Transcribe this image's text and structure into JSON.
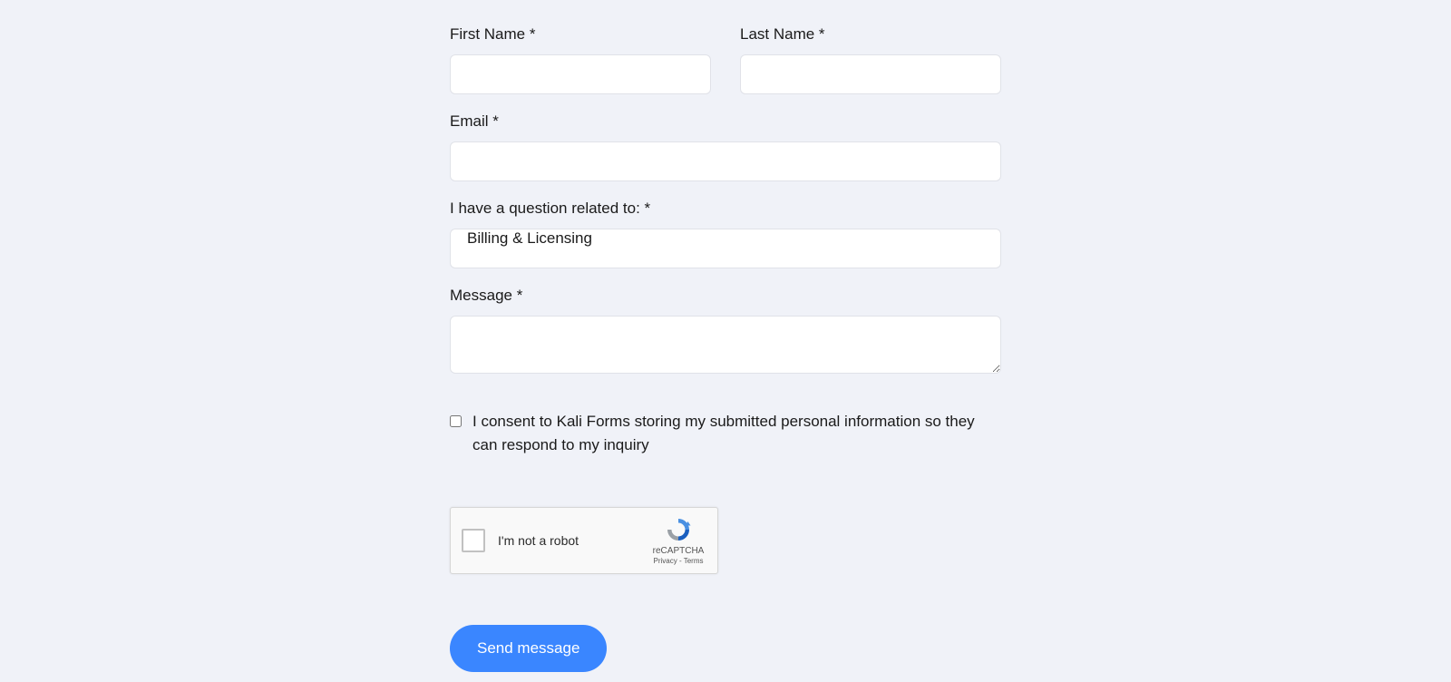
{
  "form": {
    "first_name": {
      "label": "First Name *",
      "value": ""
    },
    "last_name": {
      "label": "Last Name *",
      "value": ""
    },
    "email": {
      "label": "Email *",
      "value": ""
    },
    "topic": {
      "label": "I have a question related to: *",
      "selected": "Billing & Licensing"
    },
    "message": {
      "label": "Message *",
      "value": ""
    },
    "consent": {
      "label": "I consent to Kali Forms storing my submitted personal information so they can respond to my inquiry",
      "checked": false
    },
    "recaptcha": {
      "label": "I'm not a robot",
      "brand": "reCAPTCHA",
      "links": "Privacy - Terms"
    },
    "submit_label": "Send message"
  }
}
